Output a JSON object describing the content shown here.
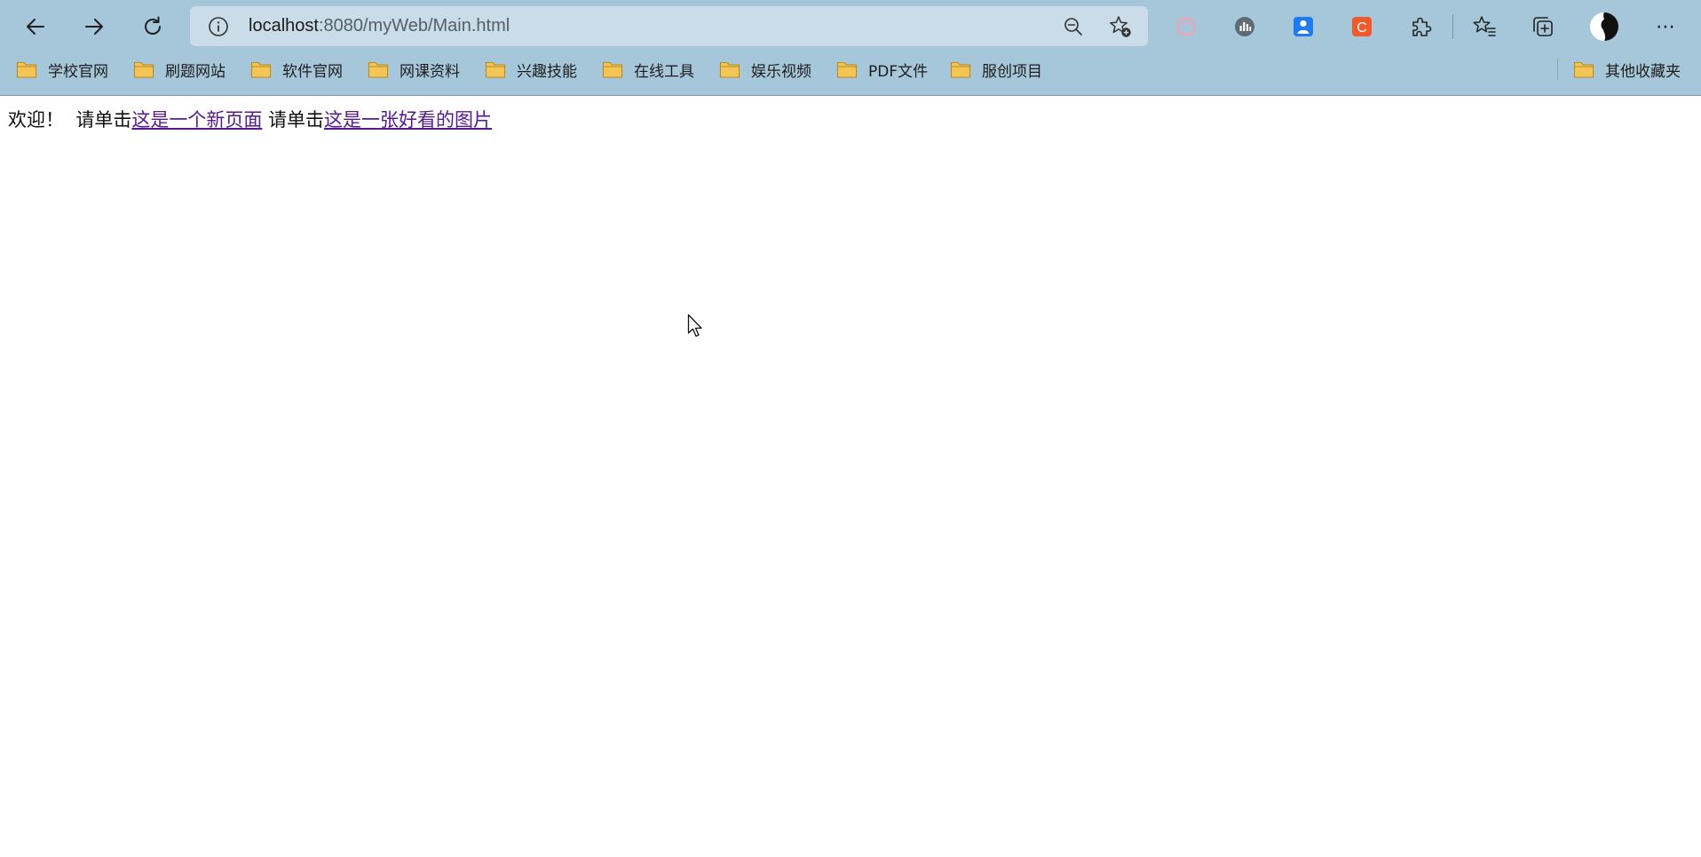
{
  "browser": {
    "nav": {
      "back_icon": "arrow-left-icon",
      "forward_icon": "arrow-right-icon",
      "reload_icon": "reload-icon"
    },
    "address_bar": {
      "url_host": "localhost",
      "url_path": ":8080/myWeb/Main.html",
      "site_info_icon": "info-icon",
      "zoom_icon": "zoom-out-icon",
      "favorite_icon": "add-favorite-icon"
    },
    "extensions": [
      {
        "icon": "pink-extension-icon",
        "color": "#f2a1b8"
      },
      {
        "icon": "chart-extension-icon",
        "color": "#5f6a73"
      },
      {
        "icon": "blue-person-extension-icon",
        "color": "#1e7bf0"
      },
      {
        "icon": "c-extension-icon",
        "color": "#f25a2c",
        "letter": "C"
      },
      {
        "icon": "puzzle-icon"
      }
    ],
    "toolbar_right": {
      "favorites_icon": "favorites-icon",
      "collections_icon": "collections-icon",
      "profile_icon": "avatar",
      "menu_icon": "more-menu-icon",
      "menu_glyph": "⋯"
    },
    "bookmarks": [
      "学校官网",
      "刷题网站",
      "软件官网",
      "网课资料",
      "兴趣技能",
      "在线工具",
      "娱乐视频",
      "PDF文件",
      "服创项目"
    ],
    "other_bookmarks": "其他收藏夹",
    "colors": {
      "chrome": "#a6c6da",
      "address_bar": "#c9dce7",
      "folder": "#f5c655",
      "link": "#551a8b"
    }
  },
  "page": {
    "welcome": "欢迎！",
    "prompt1": "请单击",
    "link1": "这是一个新页面",
    "prompt2": " 请单击",
    "link2": "这是一张好看的图片"
  }
}
